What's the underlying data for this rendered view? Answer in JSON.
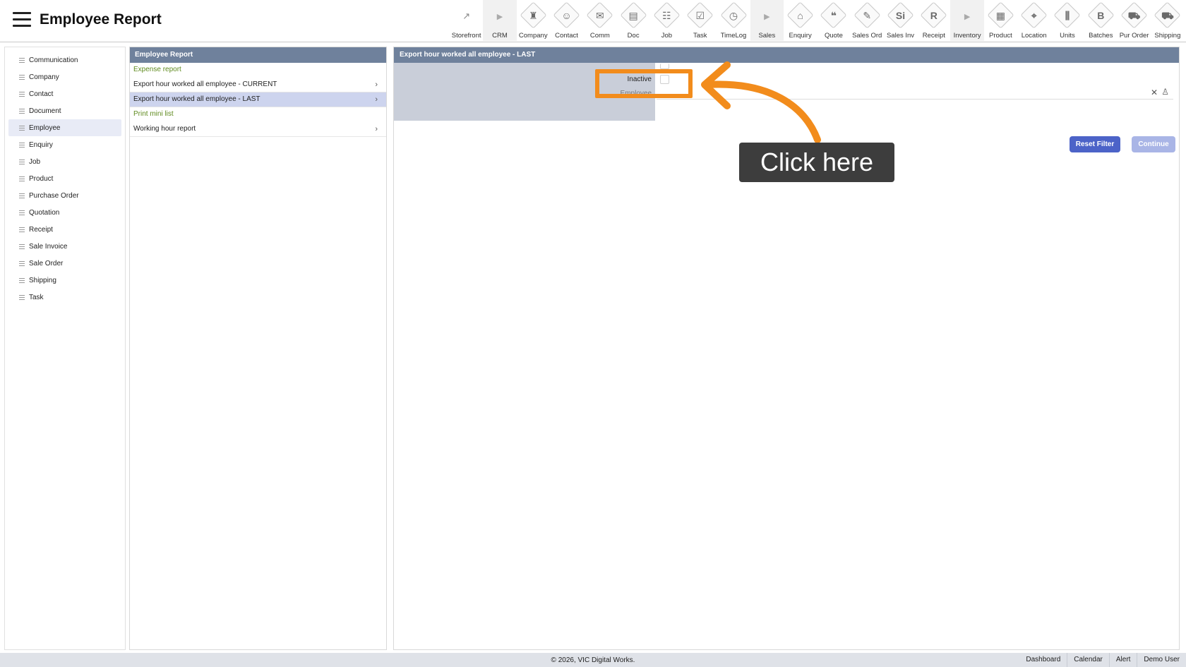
{
  "header": {
    "title": "Employee Report",
    "toolbar": [
      {
        "label": "Storefront",
        "glyph": "↗",
        "kind": "plain",
        "icon": "external-link-icon"
      },
      {
        "label": "CRM",
        "glyph": "▶",
        "kind": "arrow",
        "icon": "section-arrow-icon"
      },
      {
        "label": "Company",
        "glyph": "♜",
        "kind": "diamond",
        "icon": "company-icon"
      },
      {
        "label": "Contact",
        "glyph": "☺",
        "kind": "diamond",
        "icon": "contact-icon"
      },
      {
        "label": "Comm",
        "glyph": "✉",
        "kind": "diamond",
        "icon": "communication-icon"
      },
      {
        "label": "Doc",
        "glyph": "▤",
        "kind": "diamond",
        "icon": "document-icon"
      },
      {
        "label": "Job",
        "glyph": "☷",
        "kind": "diamond",
        "icon": "job-icon"
      },
      {
        "label": "Task",
        "glyph": "☑",
        "kind": "diamond",
        "icon": "task-icon"
      },
      {
        "label": "TimeLog",
        "glyph": "◷",
        "kind": "diamond",
        "icon": "timelog-icon"
      },
      {
        "label": "Sales",
        "glyph": "▶",
        "kind": "arrow",
        "icon": "section-arrow-icon"
      },
      {
        "label": "Enquiry",
        "glyph": "⌂",
        "kind": "diamond",
        "icon": "enquiry-icon"
      },
      {
        "label": "Quote",
        "glyph": "❝",
        "kind": "diamond",
        "icon": "quote-icon"
      },
      {
        "label": "Sales Ord",
        "glyph": "✎",
        "kind": "diamond",
        "icon": "sales-order-icon"
      },
      {
        "label": "Sales Inv",
        "glyph": "Si",
        "kind": "diamond",
        "icon": "sales-invoice-icon"
      },
      {
        "label": "Receipt",
        "glyph": "R",
        "kind": "diamond",
        "icon": "receipt-icon"
      },
      {
        "label": "Inventory",
        "glyph": "▶",
        "kind": "arrow",
        "icon": "section-arrow-icon"
      },
      {
        "label": "Product",
        "glyph": "▦",
        "kind": "diamond",
        "icon": "product-icon"
      },
      {
        "label": "Location",
        "glyph": "⌖",
        "kind": "diamond",
        "icon": "location-icon"
      },
      {
        "label": "Units",
        "glyph": "⫼",
        "kind": "diamond",
        "icon": "units-icon"
      },
      {
        "label": "Batches",
        "glyph": "B",
        "kind": "diamond",
        "icon": "batches-icon"
      },
      {
        "label": "Pur Order",
        "glyph": "⛟",
        "kind": "diamond",
        "icon": "purchase-order-icon"
      },
      {
        "label": "Shipping",
        "glyph": "⛟",
        "kind": "diamond",
        "icon": "shipping-icon"
      }
    ]
  },
  "sidebar": {
    "items": [
      {
        "label": "Communication",
        "active": false
      },
      {
        "label": "Company",
        "active": false
      },
      {
        "label": "Contact",
        "active": false
      },
      {
        "label": "Document",
        "active": false
      },
      {
        "label": "Employee",
        "active": true
      },
      {
        "label": "Enquiry",
        "active": false
      },
      {
        "label": "Job",
        "active": false
      },
      {
        "label": "Product",
        "active": false
      },
      {
        "label": "Purchase Order",
        "active": false
      },
      {
        "label": "Quotation",
        "active": false
      },
      {
        "label": "Receipt",
        "active": false
      },
      {
        "label": "Sale Invoice",
        "active": false
      },
      {
        "label": "Sale Order",
        "active": false
      },
      {
        "label": "Shipping",
        "active": false
      },
      {
        "label": "Task",
        "active": false
      }
    ]
  },
  "reports": {
    "heading": "Employee Report",
    "items": [
      {
        "label": "Expense report",
        "style": "green",
        "chevron": false
      },
      {
        "label": "Export hour worked all employee - CURRENT",
        "style": "normal",
        "chevron": true
      },
      {
        "label": "Export hour worked all employee - LAST",
        "style": "selected",
        "chevron": true
      },
      {
        "label": "Print mini list",
        "style": "green",
        "chevron": false
      },
      {
        "label": "Working hour report",
        "style": "normal",
        "chevron": true
      }
    ]
  },
  "detail": {
    "heading": "Export hour worked all employee - LAST",
    "inactive_label": "Inactive",
    "employee_label": "Employee",
    "reset_label": "Reset Filter",
    "continue_label": "Continue"
  },
  "tutorial": {
    "callout_text": "Click here",
    "accent_color": "#f28c1c"
  },
  "footer": {
    "copyright": "© 2026, VIC Digital Works.",
    "links": [
      "Dashboard",
      "Calendar",
      "Alert",
      "Demo User"
    ]
  }
}
